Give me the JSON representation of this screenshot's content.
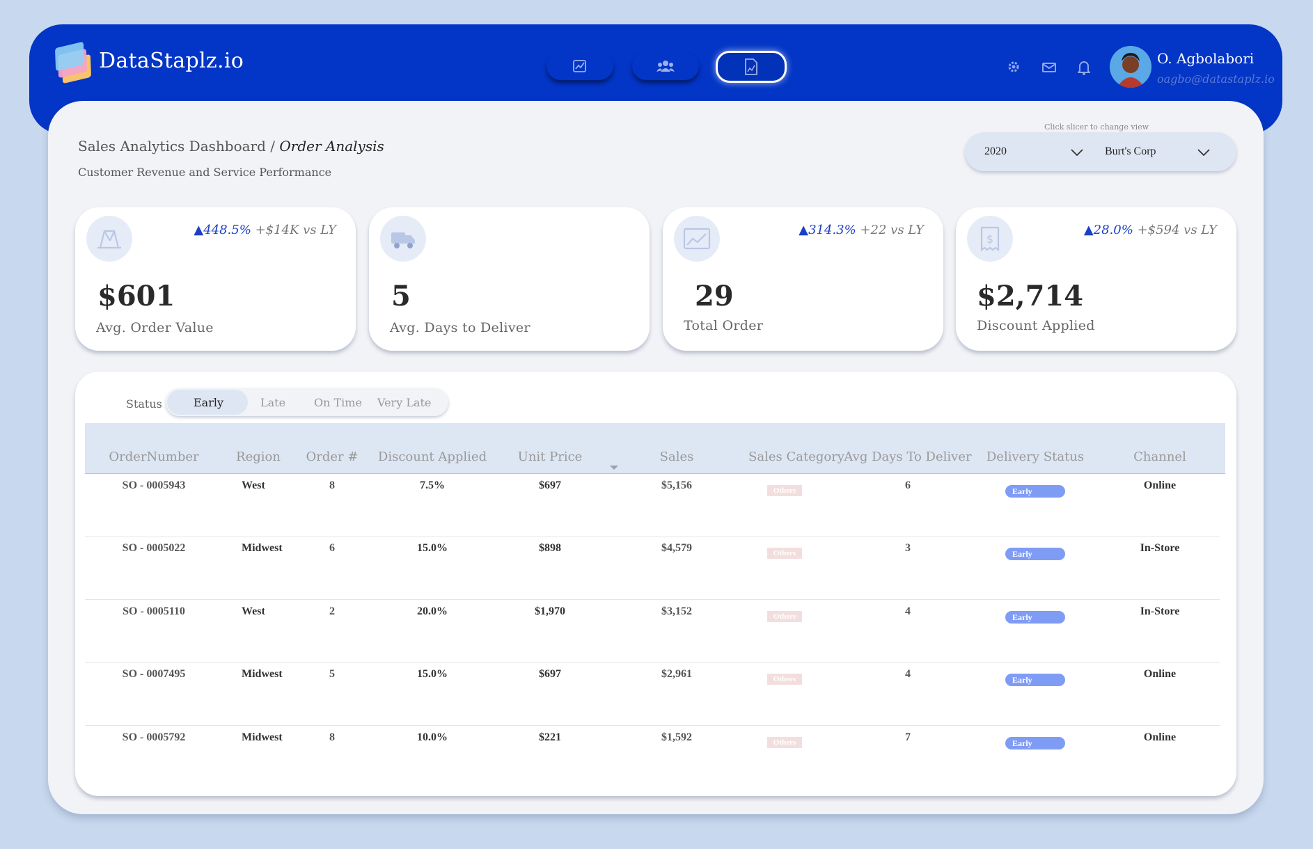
{
  "app": {
    "brand": "DataStaplz.io"
  },
  "user": {
    "name": "O. Agbolabori",
    "email": "oagbo@datastaplz.io"
  },
  "nav": [
    {
      "name": "report-icon",
      "active": false
    },
    {
      "name": "users-icon",
      "active": false
    },
    {
      "name": "invoice-icon",
      "active": true
    }
  ],
  "header_icons": [
    "gear-icon",
    "mail-icon",
    "bell-icon"
  ],
  "page": {
    "crumb_root": "Sales Analytics Dashboard / ",
    "crumb_current": "Order Analysis",
    "subtitle": "Customer Revenue and Service Performance"
  },
  "slicers": {
    "hint": "Click slicer to change view",
    "year": "2020",
    "customer": "Burt's Corp"
  },
  "kpis": [
    {
      "icon": "cart-icon",
      "pct": "▲448.5%",
      "delta": " +$14K vs LY",
      "value": "$601",
      "label": "Avg. Order Value"
    },
    {
      "icon": "truck-icon",
      "pct": "",
      "delta": "",
      "value": "5",
      "label": "Avg. Days to Deliver"
    },
    {
      "icon": "chart-icon",
      "pct": "▲314.3%",
      "delta": " +22 vs LY",
      "value": "29",
      "label": "Total Order"
    },
    {
      "icon": "dollar-receipt-icon",
      "pct": "▲28.0%",
      "delta": " +$594 vs LY",
      "value": "$2,714",
      "label": "Discount Applied"
    }
  ],
  "status_filter": {
    "label": "Status",
    "options": [
      "Early",
      "Late",
      "On Time",
      "Very Late"
    ],
    "selected": "Early"
  },
  "table": {
    "columns": [
      "OrderNumber",
      "Region",
      "Order #",
      "Discount Applied",
      "Unit Price",
      "Sales",
      "Sales Category",
      "Avg Days To Deliver",
      "Delivery Status",
      "Channel"
    ],
    "rows": [
      [
        "SO - 0005943",
        "West",
        "8",
        "7.5%",
        "$697",
        "$5,156",
        "Others",
        "6",
        "Early",
        "Online"
      ],
      [
        "SO - 0005022",
        "Midwest",
        "6",
        "15.0%",
        "$898",
        "$4,579",
        "Others",
        "3",
        "Early",
        "In-Store"
      ],
      [
        "SO - 0005110",
        "West",
        "2",
        "20.0%",
        "$1,970",
        "$3,152",
        "Others",
        "4",
        "Early",
        "In-Store"
      ],
      [
        "SO - 0007495",
        "Midwest",
        "5",
        "15.0%",
        "$697",
        "$2,961",
        "Others",
        "4",
        "Early",
        "Online"
      ],
      [
        "SO - 0005792",
        "Midwest",
        "8",
        "10.0%",
        "$221",
        "$1,592",
        "Others",
        "7",
        "Early",
        "Online"
      ]
    ]
  },
  "colors": {
    "header": "#0335c6",
    "accent": "#1b3fc6",
    "status_early": "#7f9cf5",
    "page_bg": "#c8d8ee"
  }
}
